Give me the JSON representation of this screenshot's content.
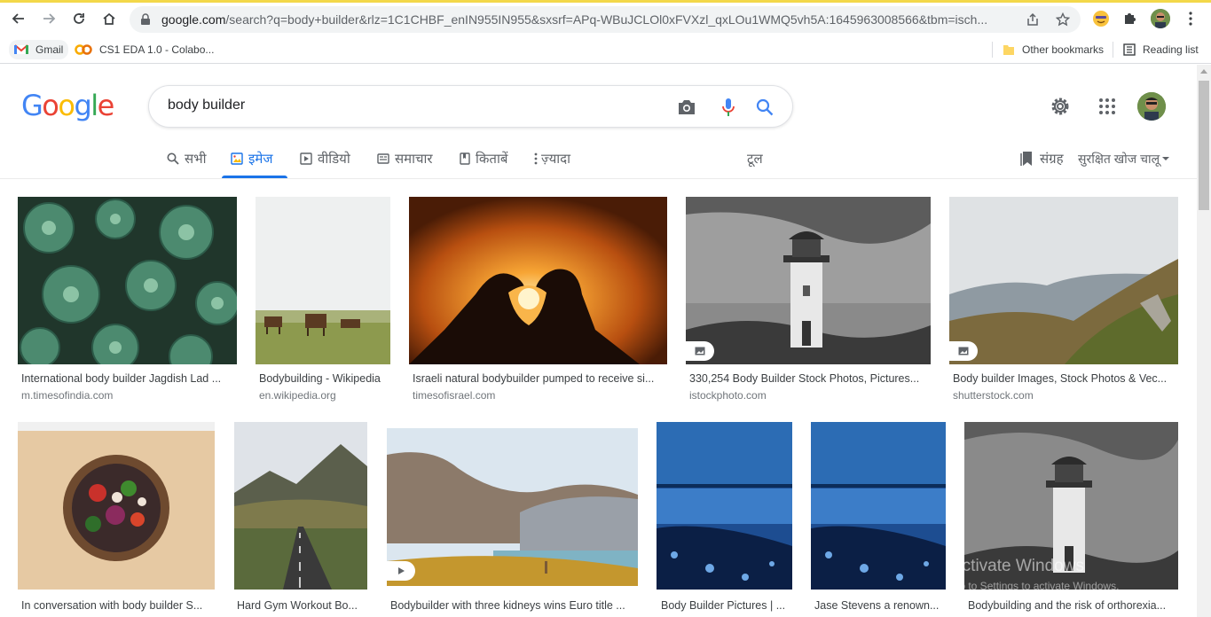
{
  "browser": {
    "url_host": "google.com",
    "url_path": "/search?q=body+builder&rlz=1C1CHBF_enIN955IN955&sxsrf=APq-WBuJCLOl0xFVXzl_qxLOu1WMQ5vh5A:1645963008566&tbm=isch...",
    "bookmarks": {
      "gmail": "Gmail",
      "colab": "CS1 EDA 1.0 - Colabo...",
      "other": "Other bookmarks",
      "reading_list": "Reading list"
    }
  },
  "google": {
    "logo": [
      "G",
      "o",
      "o",
      "g",
      "l",
      "e"
    ],
    "query": "body builder"
  },
  "tabs": {
    "all": "सभी",
    "images": "इमेज",
    "videos": "वीडियो",
    "news": "समाचार",
    "books": "किताबें",
    "more": "ज़्यादा",
    "tools": "टूल",
    "saved": "संग्रह",
    "safesearch": "सुरक्षित खोज चालू"
  },
  "results_row1": [
    {
      "caption": "International body builder Jagdish Lad ...",
      "domain": "m.timesofindia.com"
    },
    {
      "caption": "Bodybuilding - Wikipedia",
      "domain": "en.wikipedia.org"
    },
    {
      "caption": "Israeli natural bodybuilder pumped to receive si...",
      "domain": "timesofisrael.com"
    },
    {
      "caption": "330,254 Body Builder Stock Photos, Pictures...",
      "domain": "istockphoto.com"
    },
    {
      "caption": "Body builder Images, Stock Photos & Vec...",
      "domain": "shutterstock.com"
    }
  ],
  "results_row2": [
    {
      "caption": "In conversation with body builder S..."
    },
    {
      "caption": "Hard Gym Workout Bo..."
    },
    {
      "caption": "Bodybuilder with three kidneys wins Euro title ..."
    },
    {
      "caption": "Body Builder Pictures | ..."
    },
    {
      "caption": "Jase Stevens a renown..."
    },
    {
      "caption": "Bodybuilding and the risk of orthorexia..."
    }
  ],
  "watermark": {
    "line1": "Activate Windows",
    "line2": "Go to Settings to activate Windows."
  },
  "colors": {
    "accent": "#1a73e8",
    "omnibox_bg": "#f1f3f4"
  }
}
